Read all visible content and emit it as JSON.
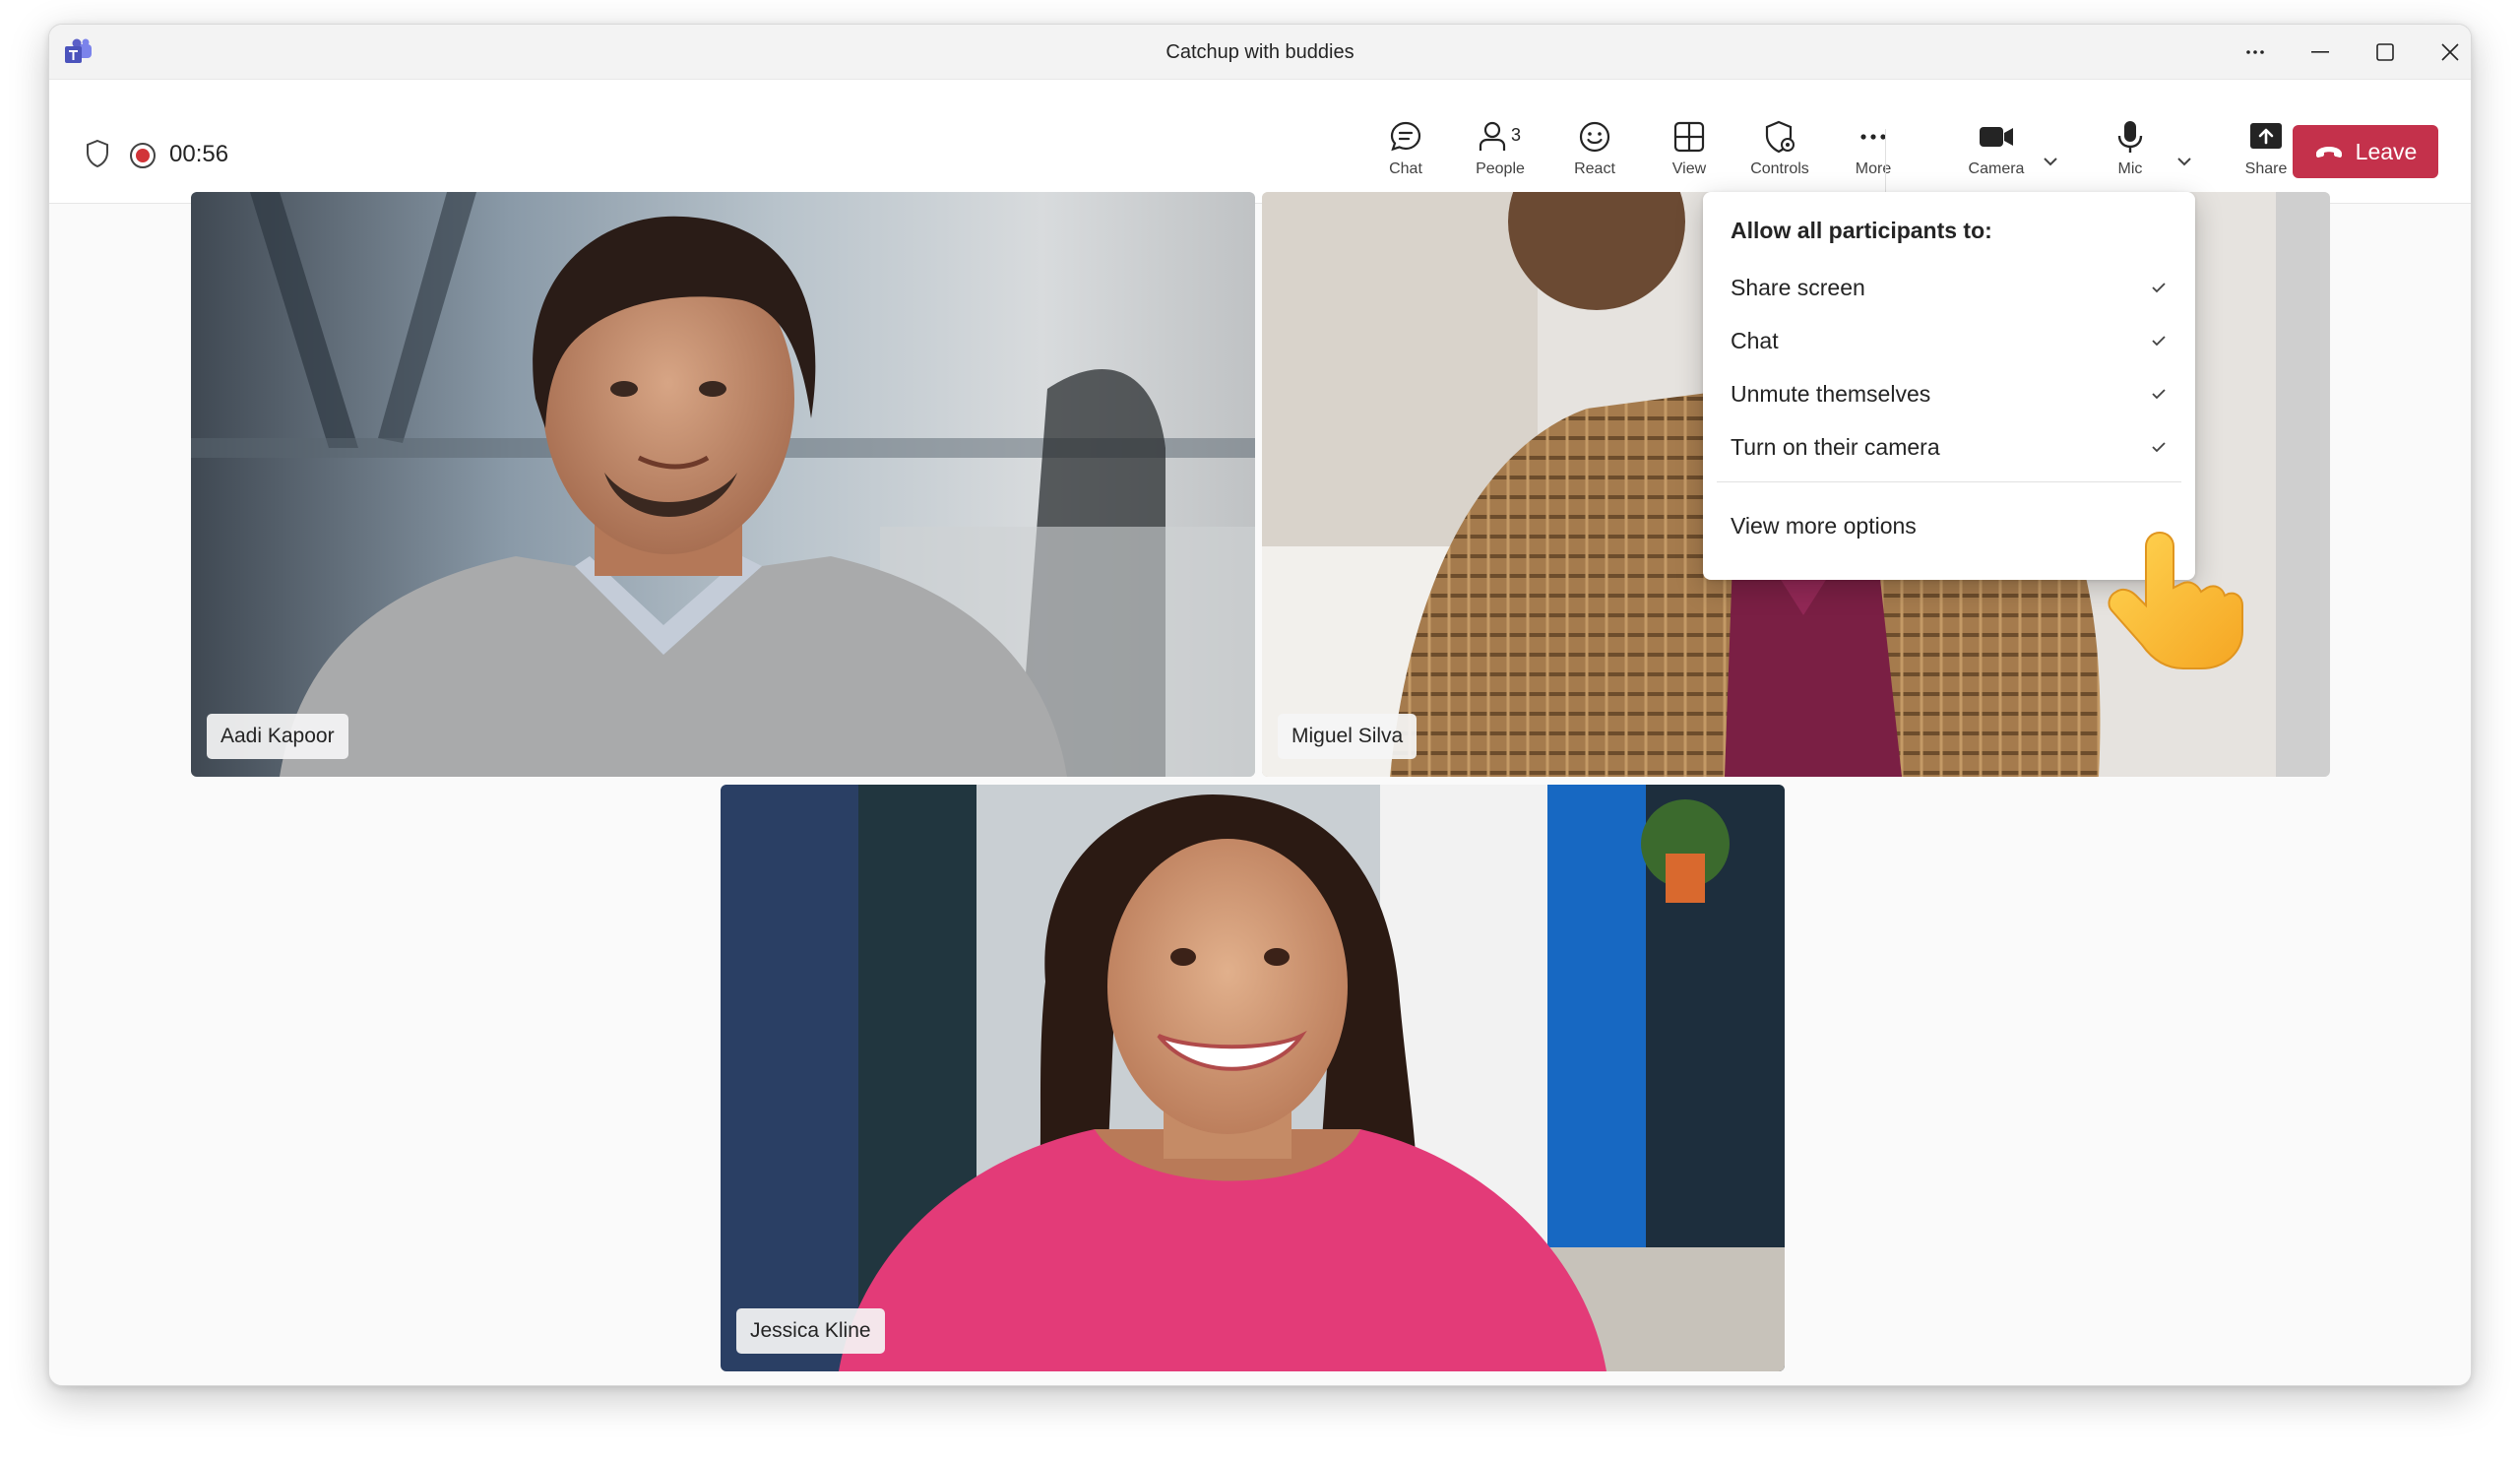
{
  "window": {
    "title": "Catchup with buddies"
  },
  "toolbar": {
    "timer": "00:56",
    "people_count": "3",
    "buttons": {
      "chat": "Chat",
      "people": "People",
      "react": "React",
      "view": "View",
      "controls": "Controls",
      "more": "More",
      "camera": "Camera",
      "mic": "Mic",
      "share": "Share"
    },
    "leave_label": "Leave"
  },
  "participants": [
    {
      "name": "Aadi Kapoor"
    },
    {
      "name": "Miguel Silva"
    },
    {
      "name": "Jessica Kline"
    }
  ],
  "controls_menu": {
    "heading": "Allow all participants to:",
    "options": [
      {
        "label": "Share screen",
        "checked": true
      },
      {
        "label": "Chat",
        "checked": true
      },
      {
        "label": "Unmute themselves",
        "checked": true
      },
      {
        "label": "Turn on their camera",
        "checked": true
      }
    ],
    "more_label": "View more options"
  },
  "colors": {
    "leave": "#c4314b",
    "teams_purple": "#5b5fc7",
    "recording": "#d13438"
  }
}
